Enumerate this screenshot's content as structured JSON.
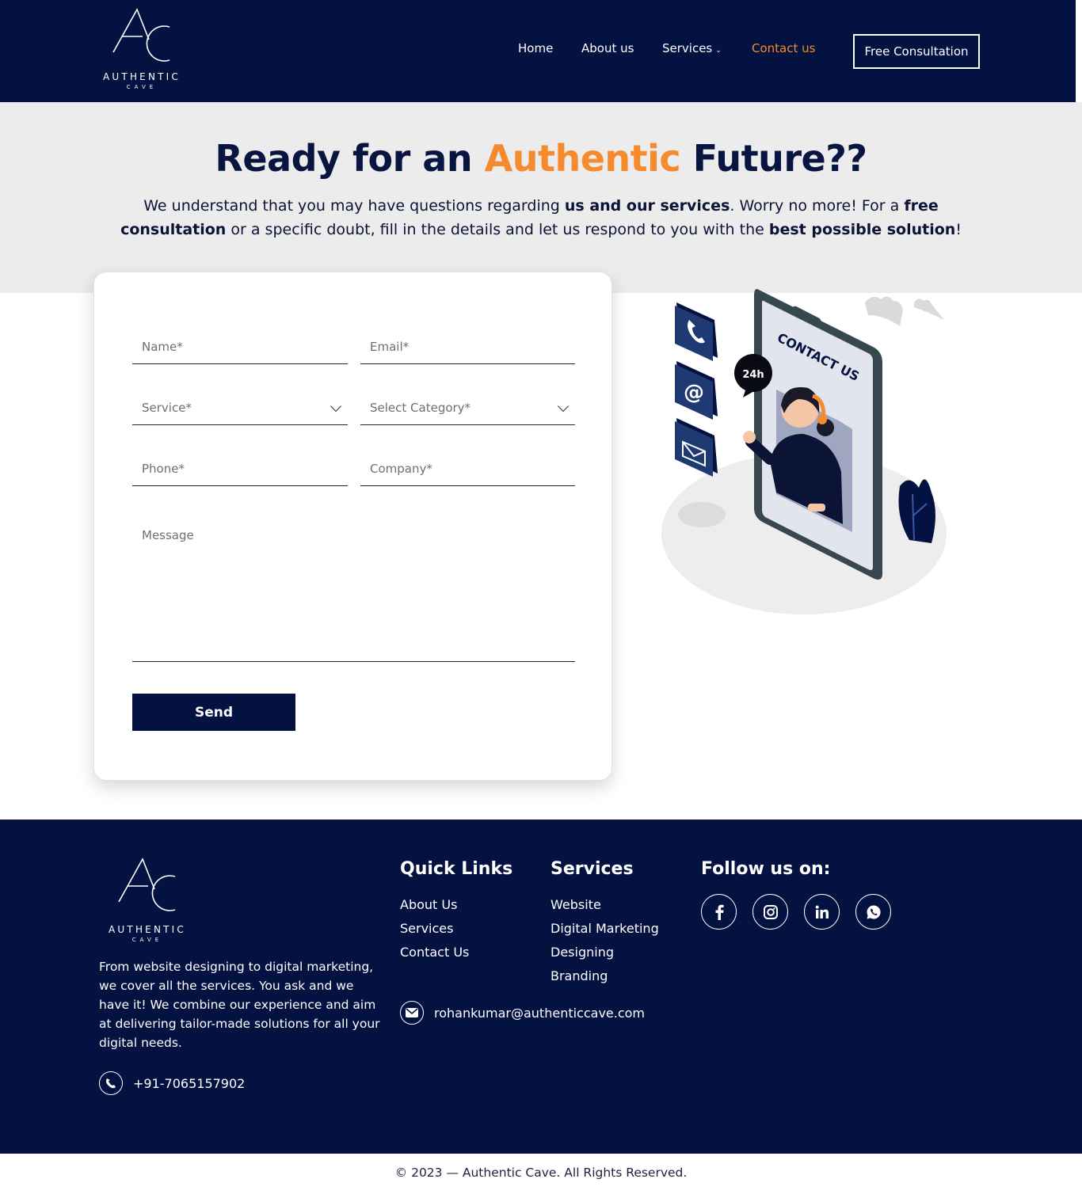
{
  "brand": {
    "name": "AUTHENTIC",
    "sub": "CAVE"
  },
  "nav": {
    "home": "Home",
    "about": "About us",
    "services": "Services",
    "contact": "Contact us",
    "cta": "Free Consultation"
  },
  "hero": {
    "title_pre": "Ready for an ",
    "title_accent": "Authentic",
    "title_post": " Future??",
    "text_1": "We understand that you may have questions regarding ",
    "text_b1": "us and our services",
    "text_2": ". Worry no more! For a ",
    "text_b2": "free consultation",
    "text_3": " or a specific doubt, fill in the details and let us respond to you with the ",
    "text_b3": "best possible solution",
    "text_4": "!"
  },
  "form": {
    "name_placeholder": "Name*",
    "email_placeholder": "Email*",
    "service_placeholder": "Service*",
    "category_placeholder": "Select Category*",
    "phone_placeholder": "Phone*",
    "company_placeholder": "Company*",
    "message_placeholder": "Message",
    "send_label": "Send"
  },
  "illustration": {
    "badge": "24h",
    "sign": "CONTACT US"
  },
  "footer": {
    "description": "From website designing to digital marketing, we cover all the services. You ask and we have it! We combine our experience and aim at delivering tailor-made solutions for all your digital needs.",
    "phone": "+91-7065157902",
    "quick_links_title": "Quick Links",
    "quick_links": [
      "About Us",
      "Services",
      "Contact Us"
    ],
    "services_title": "Services",
    "services": [
      "Website",
      "Digital Marketing",
      "Designing",
      "Branding"
    ],
    "email": "rohankumar@authenticcave.com",
    "follow_title": "Follow us on:",
    "social_icons": [
      "facebook-icon",
      "instagram-icon",
      "linkedin-icon",
      "whatsapp-icon"
    ]
  },
  "copyright": "© 2023 — Authentic Cave. All Rights Reserved.",
  "colors": {
    "navy": "#031241",
    "accent": "#f58a2e",
    "hero_bg": "#ececec"
  }
}
